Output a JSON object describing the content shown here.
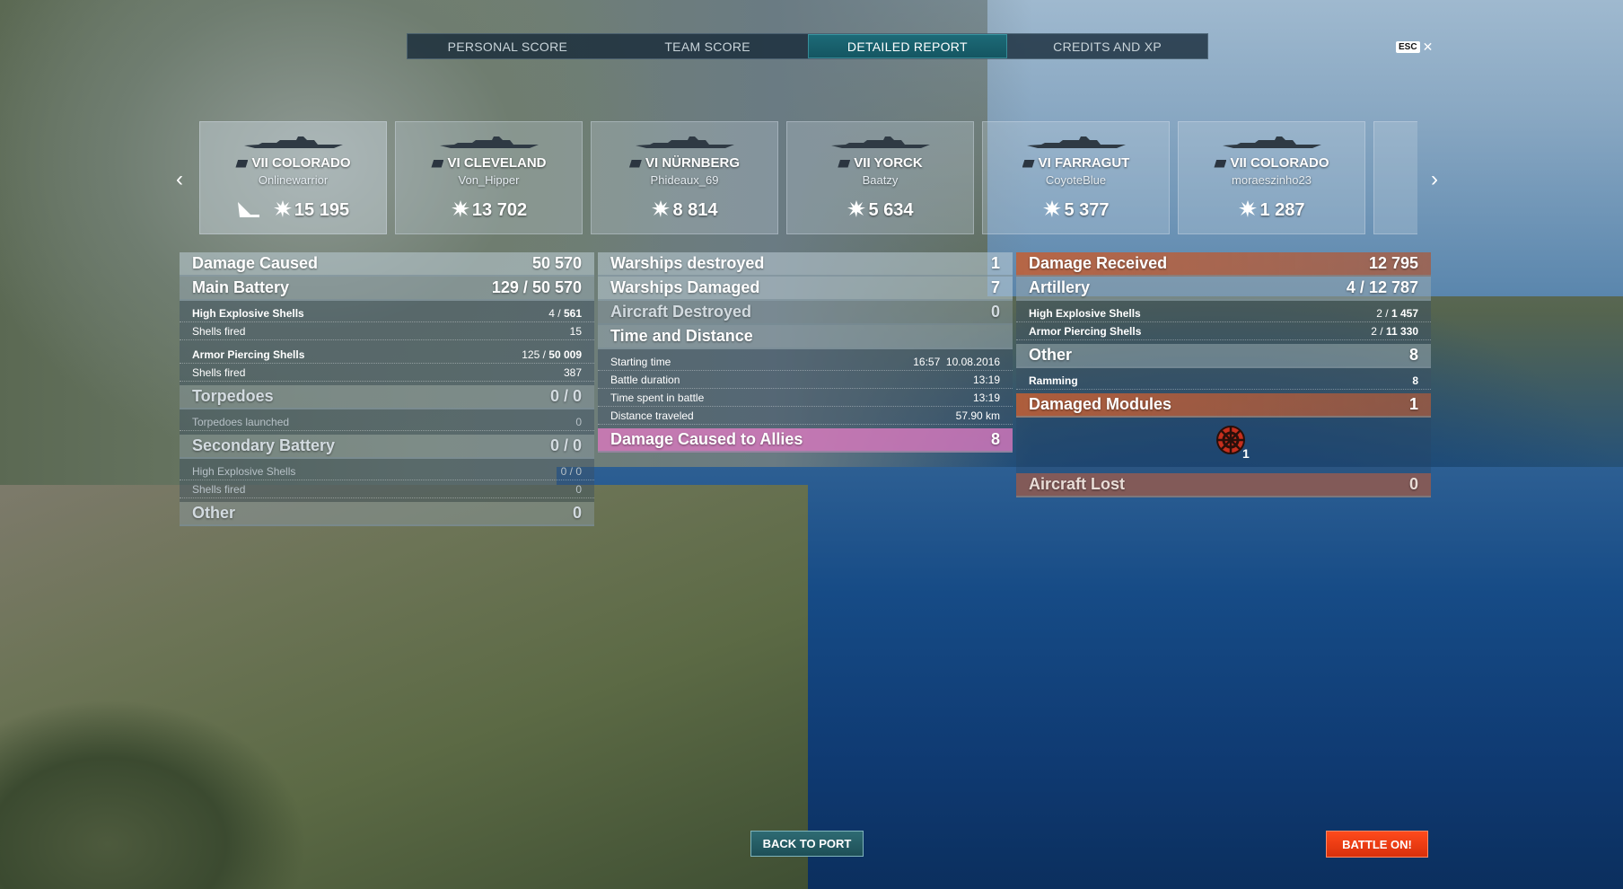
{
  "tabs": [
    "PERSONAL SCORE",
    "TEAM SCORE",
    "DETAILED REPORT",
    "CREDITS AND XP"
  ],
  "esc": {
    "key": "ESC",
    "close": "✕"
  },
  "ships": [
    {
      "name": "VII COLORADO",
      "player": "Onlinewarrior",
      "score": "15 195"
    },
    {
      "name": "VI CLEVELAND",
      "player": "Von_Hipper",
      "score": "13 702"
    },
    {
      "name": "VI NÜRNBERG",
      "player": "Phideaux_69",
      "score": "8 814"
    },
    {
      "name": "VII YORCK",
      "player": "Baatzy",
      "score": "5 634"
    },
    {
      "name": "VI FARRAGUT",
      "player": "CoyoteBlue",
      "score": "5 377"
    },
    {
      "name": "VII COLORADO",
      "player": "moraeszinho23",
      "score": "1 287"
    }
  ],
  "left": {
    "damage_caused": {
      "label": "Damage Caused",
      "value": "50 570"
    },
    "main_battery": {
      "label": "Main Battery",
      "hits": "129",
      "sep": " / ",
      "value": "50 570"
    },
    "he_shells": {
      "label": "High Explosive Shells",
      "hits": "4",
      "sep": " / ",
      "value": "561"
    },
    "he_fired": {
      "label": "Shells fired",
      "value": "15"
    },
    "ap_shells": {
      "label": "Armor Piercing Shells",
      "hits": "125",
      "sep": " / ",
      "value": "50 009"
    },
    "ap_fired": {
      "label": "Shells fired",
      "value": "387"
    },
    "torpedoes": {
      "label": "Torpedoes",
      "value": "0 / 0"
    },
    "torpedoes_launched": {
      "label": "Torpedoes launched",
      "value": "0"
    },
    "secondary": {
      "label": "Secondary Battery",
      "value": "0 / 0"
    },
    "sec_he": {
      "label": "High Explosive Shells",
      "value": "0 / 0"
    },
    "sec_fired": {
      "label": "Shells fired",
      "value": "0"
    },
    "other": {
      "label": "Other",
      "value": "0"
    }
  },
  "middle": {
    "warships_destroyed": {
      "label": "Warships destroyed",
      "value": "1"
    },
    "warships_damaged": {
      "label": "Warships Damaged",
      "value": "7"
    },
    "aircraft_destroyed": {
      "label": "Aircraft Destroyed",
      "value": "0"
    },
    "time_distance": {
      "label": "Time and Distance"
    },
    "starting_time": {
      "label": "Starting time",
      "value": "16:57  10.08.2016"
    },
    "battle_duration": {
      "label": "Battle duration",
      "value": "13:19"
    },
    "time_spent": {
      "label": "Time spent in battle",
      "value": "13:19"
    },
    "distance": {
      "label": "Distance traveled",
      "value": "57.90 km"
    },
    "allies": {
      "label": "Damage Caused to Allies",
      "value": "8"
    }
  },
  "right": {
    "damage_received": {
      "label": "Damage Received",
      "value": "12 795"
    },
    "artillery": {
      "label": "Artillery",
      "hits": "4",
      "sep": " / ",
      "value": "12 787"
    },
    "he_shells": {
      "label": "High Explosive Shells",
      "hits": "2",
      "sep": " / ",
      "value": "1 457"
    },
    "ap_shells": {
      "label": "Armor Piercing Shells",
      "hits": "2",
      "sep": " / ",
      "value": "11 330"
    },
    "other": {
      "label": "Other",
      "value": "8"
    },
    "ramming": {
      "label": "Ramming",
      "value": "8"
    },
    "damaged_modules": {
      "label": "Damaged Modules",
      "value": "1"
    },
    "module_count": "1",
    "aircraft_lost": {
      "label": "Aircraft Lost",
      "value": "0"
    }
  },
  "buttons": {
    "back": "BACK TO PORT",
    "battle": "BATTLE ON!"
  }
}
